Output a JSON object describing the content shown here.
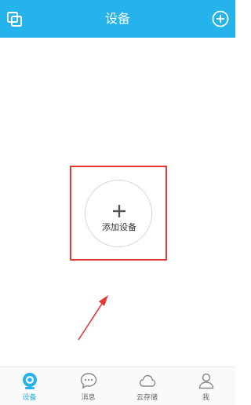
{
  "header": {
    "title": "设备",
    "left_icon": "copy-icon",
    "right_icon": "add-circle-icon"
  },
  "main": {
    "add_device_label": "添加设备",
    "add_icon": "plus-icon"
  },
  "tabbar": {
    "tabs": [
      {
        "label": "设备",
        "icon": "camera-icon",
        "active": true
      },
      {
        "label": "消息",
        "icon": "chat-bubble-icon",
        "active": false
      },
      {
        "label": "云存储",
        "icon": "cloud-icon",
        "active": false
      },
      {
        "label": "我",
        "icon": "person-icon",
        "active": false
      }
    ]
  },
  "colors": {
    "brand": "#25b3ec",
    "annotation": "#e53935"
  }
}
